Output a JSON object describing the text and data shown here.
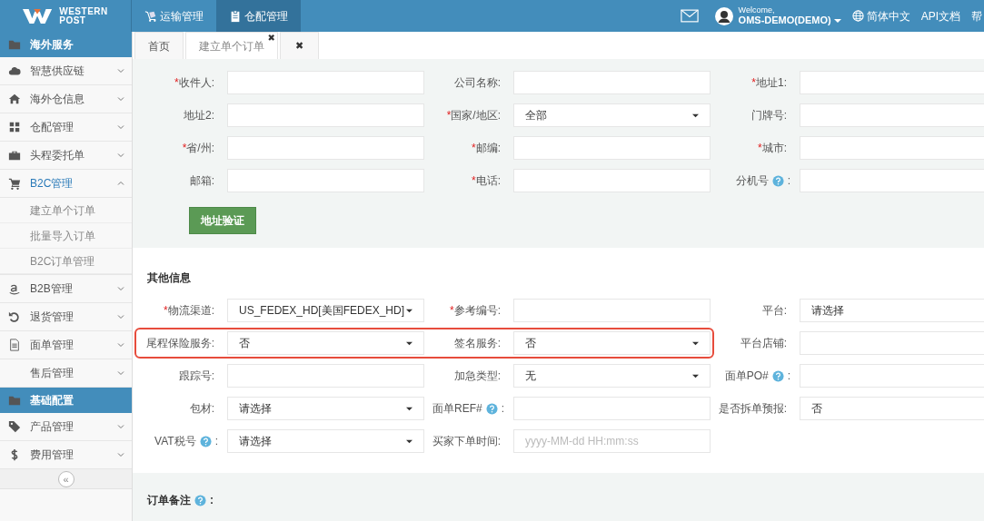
{
  "header": {
    "logo": {
      "line1": "WESTERN",
      "line2": "POST"
    },
    "nav": [
      {
        "label": "运输管理",
        "selected": false
      },
      {
        "label": "仓配管理",
        "selected": true
      }
    ],
    "user": {
      "welcome": "Welcome,",
      "name": "OMS-DEMO(DEMO)"
    },
    "language": "简体中文",
    "links": [
      "API文档",
      "帮"
    ]
  },
  "sidebar": {
    "items": [
      {
        "kind": "section",
        "label": "海外服务"
      },
      {
        "kind": "item",
        "label": "智慧供应链",
        "expanded": false,
        "selected": false
      },
      {
        "kind": "item",
        "label": "海外仓信息",
        "expanded": false,
        "selected": false
      },
      {
        "kind": "item",
        "label": "仓配管理",
        "expanded": false,
        "selected": false
      },
      {
        "kind": "item",
        "label": "头程委托单",
        "expanded": false,
        "selected": false
      },
      {
        "kind": "item",
        "label": "B2C管理",
        "expanded": true,
        "selected": true,
        "children": [
          {
            "label": "建立单个订单"
          },
          {
            "label": "批量导入订单"
          },
          {
            "label": "B2C订单管理"
          }
        ]
      },
      {
        "kind": "item",
        "label": "B2B管理",
        "expanded": false,
        "selected": false
      },
      {
        "kind": "item",
        "label": "退货管理",
        "expanded": false,
        "selected": false
      },
      {
        "kind": "item",
        "label": "面单管理",
        "expanded": false,
        "selected": false
      },
      {
        "kind": "item",
        "label": "售后管理",
        "expanded": false,
        "selected": false
      },
      {
        "kind": "section",
        "label": "基础配置"
      },
      {
        "kind": "item",
        "label": "产品管理",
        "expanded": false,
        "selected": false
      },
      {
        "kind": "item",
        "label": "费用管理",
        "expanded": false,
        "selected": false
      }
    ],
    "collapse_button": "«"
  },
  "tabs": [
    {
      "label": "首页",
      "selected": false
    },
    {
      "label": "建立单个订单",
      "selected": true,
      "close": "✖"
    },
    {
      "label": "✖",
      "selected": false
    }
  ],
  "address": {
    "rows": [
      [
        {
          "kind": "input",
          "required_mark": "*",
          "label": "收件人:"
        },
        {
          "kind": "input",
          "label": "公司名称:"
        },
        {
          "kind": "input",
          "required_mark": "*",
          "label": "地址1:"
        }
      ],
      [
        {
          "kind": "input",
          "label": "地址2:"
        },
        {
          "kind": "select",
          "required_mark": "*",
          "label": "国家/地区:",
          "value": "全部"
        },
        {
          "kind": "input",
          "label": "门牌号:"
        }
      ],
      [
        {
          "kind": "input",
          "required_mark": "*",
          "label": "省/州:"
        },
        {
          "kind": "input",
          "required_mark": "*",
          "label": "邮编:"
        },
        {
          "kind": "input",
          "required_mark": "*",
          "label": "城市:"
        }
      ],
      [
        {
          "kind": "input",
          "label": "邮箱:"
        },
        {
          "kind": "input",
          "required_mark": "*",
          "label": "电话:"
        },
        {
          "kind": "input",
          "label": "分机号",
          "help": true,
          "colon": ":"
        }
      ]
    ],
    "button": "地址验证"
  },
  "other_info": {
    "title": "其他信息",
    "rows": [
      [
        {
          "kind": "select",
          "required_mark": "*",
          "label": "物流渠道:",
          "value": "US_FEDEX_HD[美国FEDEX_HD]"
        },
        {
          "kind": "input",
          "required_mark": "*",
          "label": "参考编号:"
        },
        {
          "kind": "input",
          "label": "平台:",
          "value": "请选择"
        }
      ],
      [
        {
          "kind": "select",
          "label": "尾程保险服务:",
          "value": "否",
          "highlighted": true
        },
        {
          "kind": "select",
          "label": "签名服务:",
          "value": "否",
          "highlighted": true
        },
        {
          "kind": "input",
          "label": "平台店铺:"
        }
      ],
      [
        {
          "kind": "input",
          "label": "跟踪号:"
        },
        {
          "kind": "select",
          "label": "加急类型:",
          "value": "无"
        },
        {
          "kind": "input",
          "label": "面单PO#",
          "help": true,
          "colon": ":"
        }
      ],
      [
        {
          "kind": "select",
          "label": "包材:",
          "value": "请选择"
        },
        {
          "kind": "input",
          "label": "面单REF#",
          "help": true,
          "colon": ":"
        },
        {
          "kind": "input",
          "label": "是否拆单预报:",
          "value": "否"
        }
      ],
      [
        {
          "kind": "select",
          "label": "VAT税号",
          "help": true,
          "colon": ":",
          "value": "请选择"
        },
        {
          "kind": "input",
          "label": "买家下单时间:",
          "placeholder": "yyyy-MM-dd HH:mm:ss"
        }
      ]
    ]
  },
  "remarks": {
    "title": "订单备注",
    "help": true,
    "colon": ":"
  }
}
